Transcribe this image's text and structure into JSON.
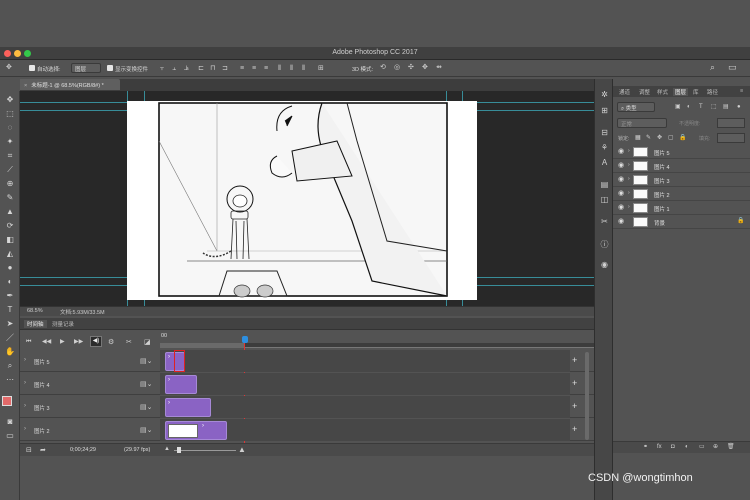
{
  "app": {
    "title": "Adobe Photoshop CC 2017"
  },
  "options_bar": {
    "auto_select_label": "自动选择:",
    "auto_select_value": "图层",
    "show_transform_label": "显示变换控件",
    "mode_3d_label": "3D 模式:"
  },
  "document": {
    "tab_title": "未标题-1 @ 68.5%(RGB/8#) *",
    "zoom": "68.5%",
    "doc_info": "文档:5.93M/33.5M"
  },
  "timeline": {
    "tabs": [
      "时间轴",
      "测量记录"
    ],
    "time_start": "00",
    "current_time": "0;00;24;29",
    "fps": "(29.97 fps)",
    "layers": [
      {
        "label": "图片 5"
      },
      {
        "label": "图片 4"
      },
      {
        "label": "图片 3"
      },
      {
        "label": "图片 2"
      }
    ]
  },
  "panels": {
    "tabs": [
      "通道",
      "调整",
      "样式",
      "图层",
      "库",
      "路径"
    ],
    "active_tab": "图层",
    "filter_kind": "类型",
    "blend_mode": "正常",
    "opacity_label": "不透明度:",
    "lock_label": "锁定:",
    "fill_label": "填充:",
    "layers": [
      {
        "name": "图片 5"
      },
      {
        "name": "图片 4"
      },
      {
        "name": "图片 3"
      },
      {
        "name": "图片 2"
      },
      {
        "name": "图片 1"
      },
      {
        "name": "背景"
      }
    ]
  },
  "watermark": "CSDN @wongtimhon",
  "colors": {
    "accent_purple": "#8a63c4",
    "guide_cyan": "#3fb8c9",
    "selection_red": "#e02020"
  }
}
